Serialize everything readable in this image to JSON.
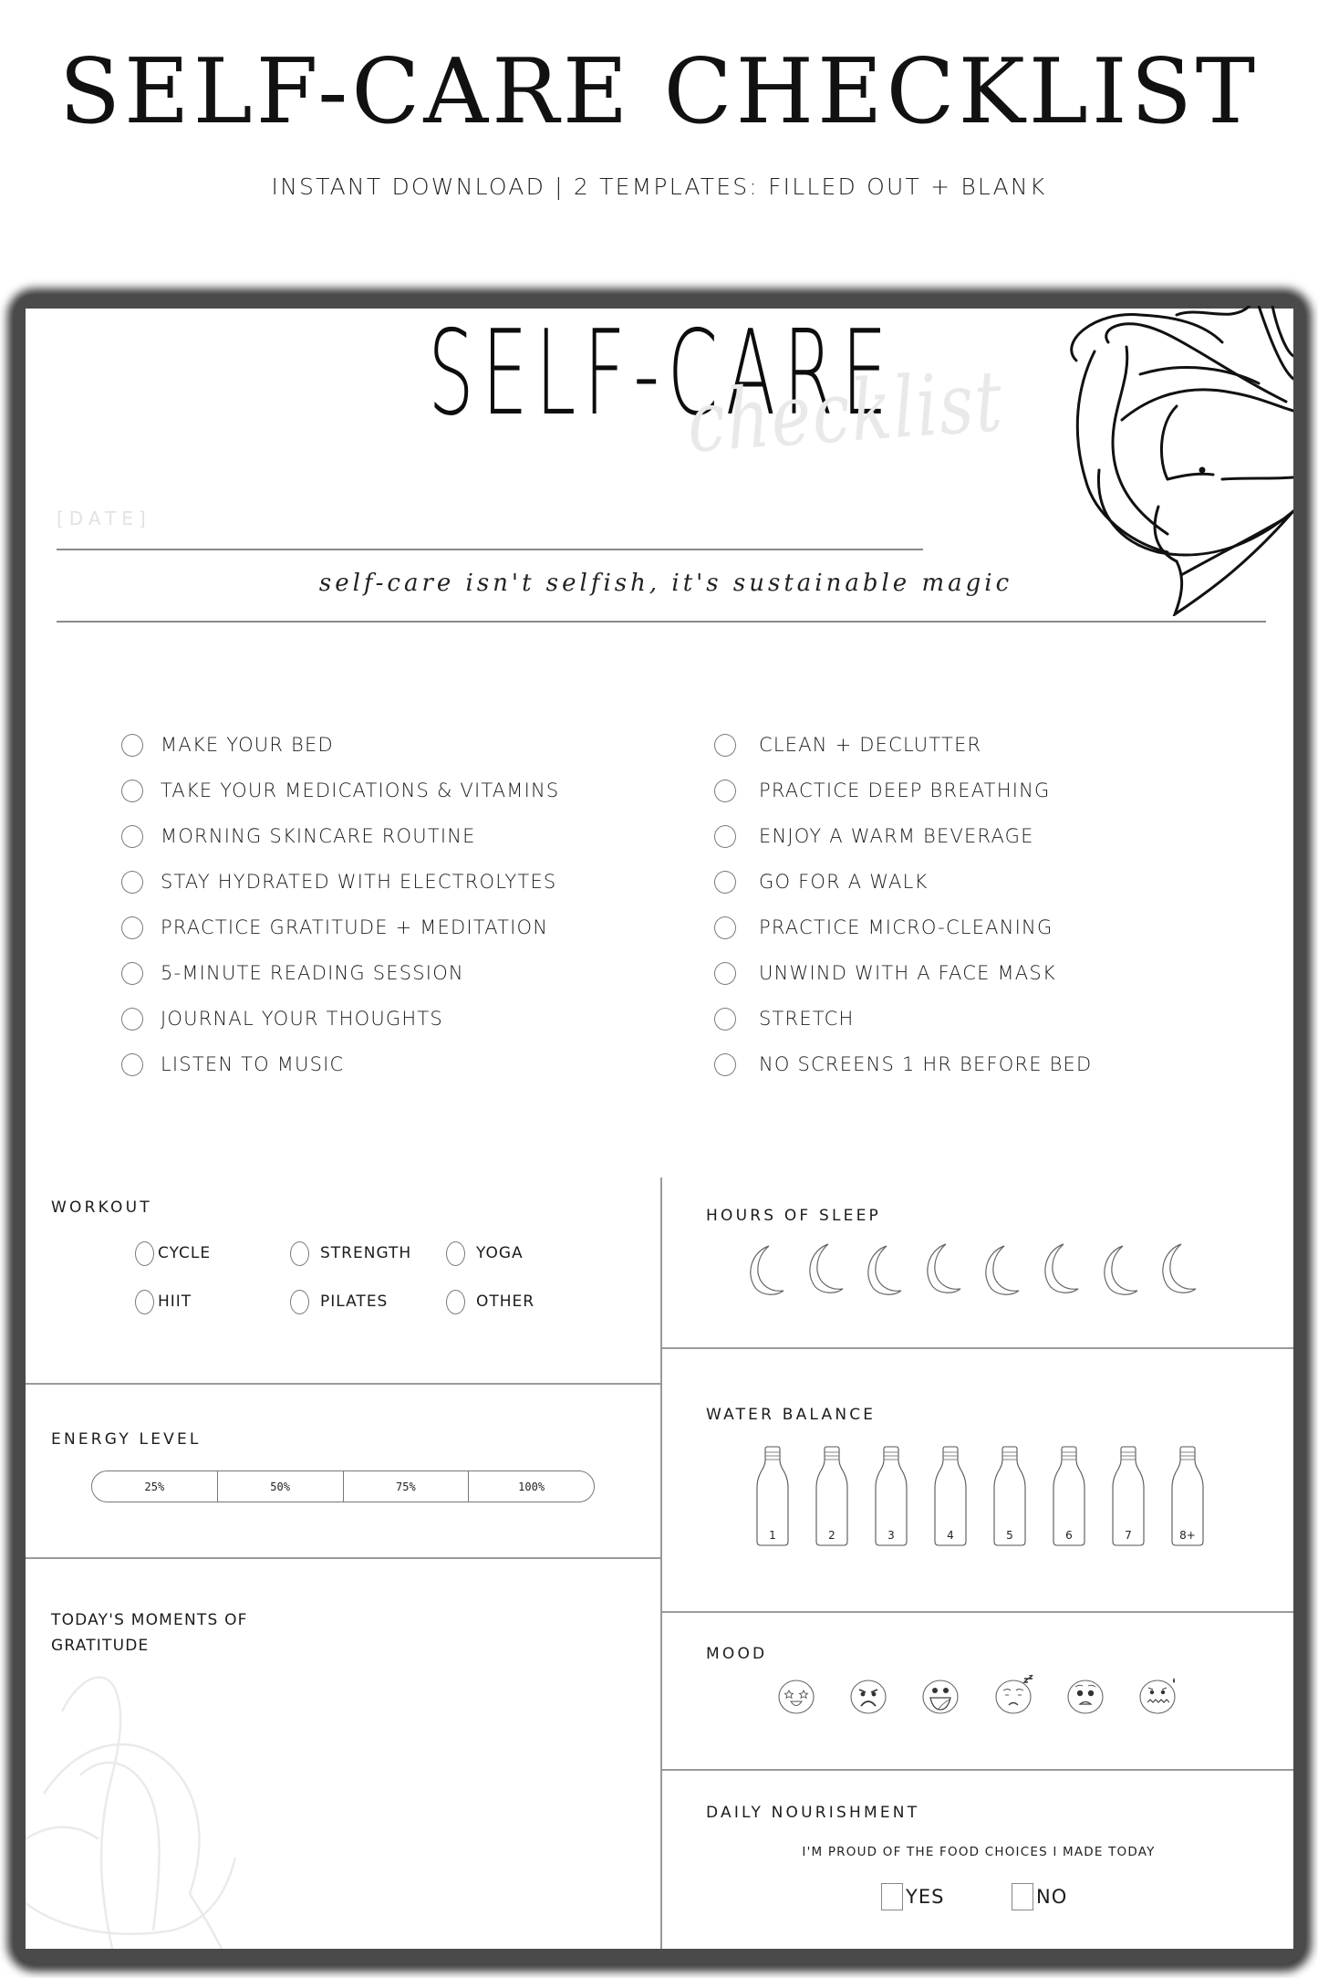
{
  "banner": {
    "title": "SELF-CARE CHECKLIST",
    "subtitle": "INSTANT DOWNLOAD | 2 TEMPLATES: FILLED OUT + BLANK"
  },
  "card": {
    "title": "SELF-CARE",
    "subtitle": "checklist",
    "date_placeholder": "[DATE]",
    "quote": "self-care isn't selfish, it's sustainable magic"
  },
  "checklist": {
    "left": [
      {
        "label": "MAKE YOUR BED",
        "checked": false
      },
      {
        "label": "TAKE YOUR MEDICATIONS & VITAMINS",
        "checked": false
      },
      {
        "label": "MORNING SKINCARE ROUTINE",
        "checked": false
      },
      {
        "label": "STAY HYDRATED WITH ELECTROLYTES",
        "checked": false
      },
      {
        "label": "PRACTICE GRATITUDE + MEDITATION",
        "checked": false
      },
      {
        "label": "5-MINUTE READING SESSION",
        "checked": false
      },
      {
        "label": "JOURNAL YOUR THOUGHTS",
        "checked": false
      },
      {
        "label": "LISTEN TO MUSIC",
        "checked": false
      }
    ],
    "right": [
      {
        "label": "CLEAN + DECLUTTER",
        "checked": false
      },
      {
        "label": "PRACTICE DEEP BREATHING",
        "checked": false
      },
      {
        "label": "ENJOY A WARM BEVERAGE",
        "checked": false
      },
      {
        "label": "GO FOR A WALK",
        "checked": false
      },
      {
        "label": "PRACTICE MICRO-CLEANING",
        "checked": false
      },
      {
        "label": "UNWIND WITH A FACE MASK",
        "checked": false
      },
      {
        "label": "STRETCH",
        "checked": false
      },
      {
        "label": "NO SCREENS 1 HR BEFORE BED",
        "checked": false
      }
    ]
  },
  "workout": {
    "label": "WORKOUT",
    "options": [
      "CYCLE",
      "STRENGTH",
      "YOGA",
      "HIIT",
      "PILATES",
      "OTHER"
    ]
  },
  "energy": {
    "label": "ENERGY LEVEL",
    "levels": [
      "25%",
      "50%",
      "75%",
      "100%"
    ]
  },
  "gratitude": {
    "label_line1": "TODAY'S MOMENTS OF",
    "label_line2": "GRATITUDE"
  },
  "sleep": {
    "label": "HOURS OF SLEEP",
    "moon_count": 8,
    "icon": "crescent-moon-icon"
  },
  "water": {
    "label": "WATER BALANCE",
    "bottles": [
      "1",
      "2",
      "3",
      "4",
      "5",
      "6",
      "7",
      "8+"
    ],
    "icon": "water-bottle-icon"
  },
  "mood": {
    "label": "MOOD",
    "faces": [
      "star-struck",
      "angry",
      "grinning",
      "sleepy",
      "worried",
      "anxious"
    ]
  },
  "nourishment": {
    "label": "DAILY NOURISHMENT",
    "question": "I'M PROUD OF THE FOOD CHOICES I MADE TODAY",
    "yes_label": "YES",
    "no_label": "NO"
  },
  "colors": {
    "text": "#1a1a1a",
    "frame": "#4a4a4a",
    "divider": "#9a9a9a",
    "watermark": "#e9e9e9"
  }
}
